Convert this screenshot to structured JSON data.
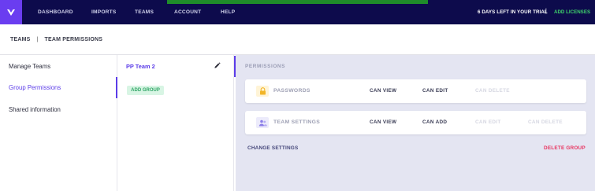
{
  "topnav": {
    "items": [
      "DASHBOARD",
      "IMPORTS",
      "TEAMS",
      "ACCOUNT",
      "HELP"
    ],
    "trial_text": "6 DAYS LEFT IN YOUR TRIAL",
    "separator": "|",
    "add_licenses": "ADD LICENSES",
    "logo_icon": "chevron-v-logo",
    "colors": {
      "nav_bg": "#0d0b4c",
      "logo_bg": "#6a3df0",
      "strip": "#1f8d2a",
      "accent": "#5b3ce8"
    }
  },
  "breadcrumb": {
    "root": "TEAMS",
    "divider": "|",
    "current": "TEAM PERMISSIONS"
  },
  "sidebar": {
    "items": [
      {
        "label": "Manage Teams",
        "active": false
      },
      {
        "label": "Group Permissions",
        "active": true
      },
      {
        "label": "Shared information",
        "active": false
      }
    ]
  },
  "team_column": {
    "team_name": "PP Team 2",
    "edit_icon": "pencil-icon",
    "add_group_label": "ADD GROUP"
  },
  "permissions": {
    "heading": "PERMISSIONS",
    "rows": [
      {
        "label": "PASSWORDS",
        "icon": "lock-icon",
        "options": [
          {
            "label": "CAN VIEW",
            "enabled": true
          },
          {
            "label": "CAN EDIT",
            "enabled": true
          },
          {
            "label": "CAN DELETE",
            "enabled": false
          }
        ]
      },
      {
        "label": "TEAM SETTINGS",
        "icon": "users-icon",
        "options": [
          {
            "label": "CAN VIEW",
            "enabled": true
          },
          {
            "label": "CAN ADD",
            "enabled": true
          },
          {
            "label": "CAN EDIT",
            "enabled": false
          },
          {
            "label": "CAN DELETE",
            "enabled": false
          }
        ]
      }
    ],
    "change_settings": "CHANGE SETTINGS",
    "delete_group": "DELETE GROUP"
  }
}
